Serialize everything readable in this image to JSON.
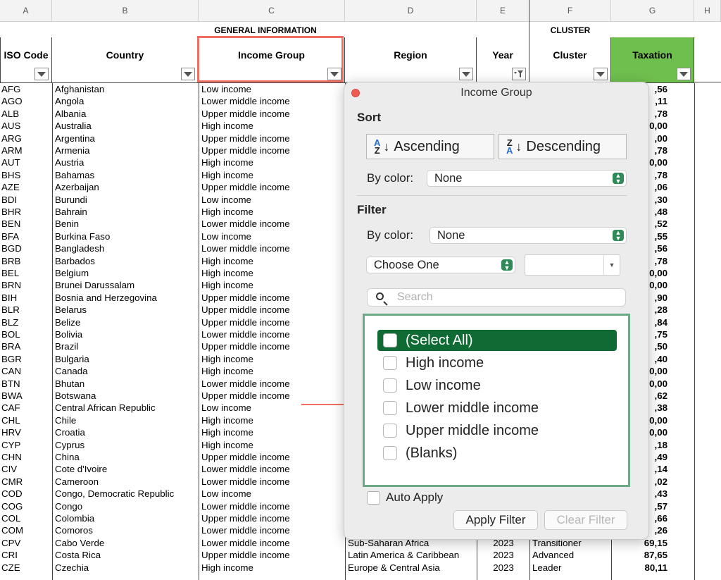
{
  "column_letters": [
    "A",
    "B",
    "C",
    "D",
    "E",
    "F",
    "G",
    "H"
  ],
  "group_titles": {
    "general": "GENERAL INFORMATION",
    "cluster": "CLUSTER"
  },
  "headers": {
    "iso": "ISO Code",
    "country": "Country",
    "income": "Income Group",
    "region": "Region",
    "year": "Year",
    "cluster": "Cluster",
    "taxation": "Taxation"
  },
  "rows": [
    {
      "iso": "AFG",
      "country": "Afghanistan",
      "income": "Low income",
      "tax": ",56"
    },
    {
      "iso": "AGO",
      "country": "Angola",
      "income": "Lower middle income",
      "tax": ",11"
    },
    {
      "iso": "ALB",
      "country": "Albania",
      "income": "Upper middle income",
      "tax": ",78"
    },
    {
      "iso": "AUS",
      "country": "Australia",
      "income": "High income",
      "tax": "0,00"
    },
    {
      "iso": "ARG",
      "country": "Argentina",
      "income": "Upper middle income",
      "tax": ",00"
    },
    {
      "iso": "ARM",
      "country": "Armenia",
      "income": "Upper middle income",
      "tax": ",78"
    },
    {
      "iso": "AUT",
      "country": "Austria",
      "income": "High income",
      "tax": "0,00"
    },
    {
      "iso": "BHS",
      "country": "Bahamas",
      "income": "High income",
      "tax": ",78"
    },
    {
      "iso": "AZE",
      "country": "Azerbaijan",
      "income": "Upper middle income",
      "tax": ",06"
    },
    {
      "iso": "BDI",
      "country": "Burundi",
      "income": "Low income",
      "tax": ",30"
    },
    {
      "iso": "BHR",
      "country": "Bahrain",
      "income": "High income",
      "tax": ",48"
    },
    {
      "iso": "BEN",
      "country": "Benin",
      "income": "Lower middle income",
      "tax": ",52"
    },
    {
      "iso": "BFA",
      "country": "Burkina Faso",
      "income": "Low income",
      "tax": ",55"
    },
    {
      "iso": "BGD",
      "country": "Bangladesh",
      "income": "Lower middle income",
      "tax": ",56"
    },
    {
      "iso": "BRB",
      "country": "Barbados",
      "income": "High income",
      "tax": ",78"
    },
    {
      "iso": "BEL",
      "country": "Belgium",
      "income": "High income",
      "tax": "0,00"
    },
    {
      "iso": "BRN",
      "country": "Brunei Darussalam",
      "income": "High income",
      "tax": "0,00"
    },
    {
      "iso": "BIH",
      "country": "Bosnia and Herzegovina",
      "income": "Upper middle income",
      "tax": ",90"
    },
    {
      "iso": "BLR",
      "country": "Belarus",
      "income": "Upper middle income",
      "tax": ",28"
    },
    {
      "iso": "BLZ",
      "country": "Belize",
      "income": "Upper middle income",
      "tax": ",84"
    },
    {
      "iso": "BOL",
      "country": "Bolivia",
      "income": "Lower middle income",
      "tax": ",75"
    },
    {
      "iso": "BRA",
      "country": "Brazil",
      "income": "Upper middle income",
      "tax": ",50"
    },
    {
      "iso": "BGR",
      "country": "Bulgaria",
      "income": "High income",
      "tax": ",40"
    },
    {
      "iso": "CAN",
      "country": "Canada",
      "income": "High income",
      "tax": "0,00"
    },
    {
      "iso": "BTN",
      "country": "Bhutan",
      "income": "Lower middle income",
      "tax": "0,00"
    },
    {
      "iso": "BWA",
      "country": "Botswana",
      "income": "Upper middle income",
      "tax": ",62"
    },
    {
      "iso": "CAF",
      "country": "Central African Republic",
      "income": "Low income",
      "tax": ",38"
    },
    {
      "iso": "CHL",
      "country": "Chile",
      "income": "High income",
      "tax": "0,00"
    },
    {
      "iso": "HRV",
      "country": "Croatia",
      "income": "High income",
      "tax": "0,00"
    },
    {
      "iso": "CYP",
      "country": "Cyprus",
      "income": "High income",
      "tax": ",18"
    },
    {
      "iso": "CHN",
      "country": "China",
      "income": "Upper middle income",
      "tax": ",49"
    },
    {
      "iso": "CIV",
      "country": "Cote d'Ivoire",
      "income": "Lower middle income",
      "tax": ",14"
    },
    {
      "iso": "CMR",
      "country": "Cameroon",
      "income": "Lower middle income",
      "tax": ",02"
    },
    {
      "iso": "COD",
      "country": "Congo, Democratic Republic",
      "income": "Low income",
      "tax": ",43"
    },
    {
      "iso": "COG",
      "country": "Congo",
      "income": "Lower middle income",
      "tax": ",57"
    },
    {
      "iso": "COL",
      "country": "Colombia",
      "income": "Upper middle income",
      "tax": ",66"
    },
    {
      "iso": "COM",
      "country": "Comoros",
      "income": "Lower middle income",
      "tax": ",26"
    },
    {
      "iso": "CPV",
      "country": "Cabo Verde",
      "income": "Lower middle income",
      "region": "Sub-Saharan Africa",
      "year": "2023",
      "cluster": "Transitioner",
      "tax": "69,15"
    },
    {
      "iso": "CRI",
      "country": "Costa Rica",
      "income": "Upper middle income",
      "region": "Latin America & Caribbean",
      "year": "2023",
      "cluster": "Advanced",
      "tax": "87,65"
    },
    {
      "iso": "CZE",
      "country": "Czechia",
      "income": "High income",
      "region": "Europe & Central Asia",
      "year": "2023",
      "cluster": "Leader",
      "tax": "80,11"
    }
  ],
  "panel": {
    "title": "Income Group",
    "sort_label": "Sort",
    "ascending": "Ascending",
    "descending": "Descending",
    "by_color_label": "By color:",
    "sort_color_value": "None",
    "filter_label": "Filter",
    "filter_color_value": "None",
    "choose_one": "Choose One",
    "search_placeholder": "Search",
    "items": [
      "(Select All)",
      "High income",
      "Low income",
      "Lower middle income",
      "Upper middle income",
      "(Blanks)"
    ],
    "auto_apply": "Auto Apply",
    "apply_filter": "Apply Filter",
    "clear_filter": "Clear Filter"
  },
  "colors": {
    "highlight_box": "#ef6f62",
    "taxation_header": "#6fbf4f",
    "select_all_bg": "#0f6b33",
    "list_border": "#6fa887",
    "arrow": "#ef6f62"
  }
}
